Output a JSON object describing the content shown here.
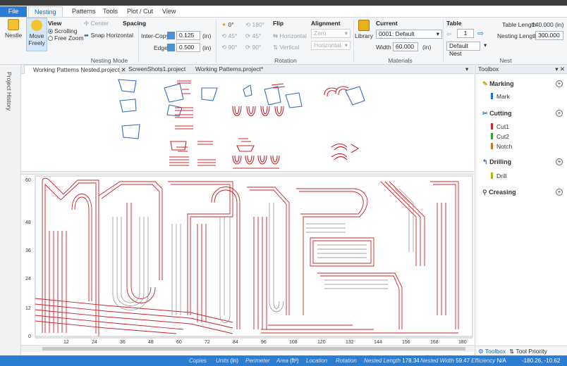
{
  "menu": {
    "file": "File",
    "tabs": [
      "Nesting",
      "Patterns",
      "Tools",
      "Plot / Cut",
      "View"
    ]
  },
  "ribbon": {
    "nestle": "Nestle",
    "move_freely": "Move Freely",
    "view_title": "View",
    "scrolling": "Scrolling",
    "free_zoom": "Free Zoom",
    "center": "Center",
    "snap_horizontal": "Snap Horizontal",
    "nesting_mode": "Nesting Mode",
    "spacing_title": "Spacing",
    "inter_copy_label": "Inter-Copy",
    "inter_copy_value": "0.125",
    "inter_copy_unit": "(in)",
    "edge_label": "Edge",
    "edge_value": "0.500",
    "edge_unit": "(in)",
    "rot_0": "0°",
    "rot_180": "180°",
    "rot_45a": "45°",
    "rot_45b": "45°",
    "rot_90a": "90°",
    "rot_90b": "90°",
    "flip_title": "Flip",
    "flip_horizontal": "Horizontal",
    "flip_vertical": "Vertical",
    "align_title": "Alignment",
    "align_zero": "Zero",
    "align_horizontal": "Horizontal",
    "rotation": "Rotation",
    "library": "Library",
    "current_title": "Current",
    "current_material": "0001: Default",
    "width_label": "Width",
    "width_value": "60.000",
    "width_unit": "(in)",
    "materials": "Materials",
    "table_title": "Table",
    "table_value": "1",
    "default_nest": "Default Nest",
    "table_length_label": "Table Length",
    "table_length_value": "140.000 (in)",
    "nesting_length_label": "Nesting Length",
    "nesting_length_value": "300.000",
    "nest": "Nest"
  },
  "sidebar": {
    "label": "Project History"
  },
  "doc_tabs": [
    "Working Patterns Nested.project",
    "ScreenShots1.project",
    "Working Patterns.project*"
  ],
  "nest_axes": {
    "y": [
      "60",
      "48",
      "36",
      "24",
      "12",
      "0"
    ],
    "x": [
      "12",
      "24",
      "36",
      "48",
      "60",
      "72",
      "84",
      "96",
      "108",
      "120",
      "132",
      "144",
      "156",
      "168",
      "180"
    ]
  },
  "toolbox": {
    "title": "Toolbox",
    "categories": [
      {
        "name": "Marking",
        "items": [
          {
            "label": "Mark",
            "color": "#1f6fd1"
          }
        ]
      },
      {
        "name": "Cutting",
        "items": [
          {
            "label": "Cut1",
            "color": "#d62828"
          },
          {
            "label": "Cut2",
            "color": "#2aa52a"
          },
          {
            "label": "Notch",
            "color": "#c47a1c"
          }
        ]
      },
      {
        "name": "Drilling",
        "items": [
          {
            "label": "Drill",
            "color": "#b7b214"
          }
        ]
      },
      {
        "name": "Creasing",
        "items": []
      }
    ],
    "footer_tab1": "Toolbox",
    "footer_tab2": "Tool Priority"
  },
  "status": {
    "copies": "Copies",
    "units_label": "Units",
    "units_value": "(in)",
    "perimeter": "Perimeter",
    "area_label": "Area",
    "area_value": "(ft²)",
    "location": "Location",
    "rotation": "Rotation",
    "nested_length_label": "Nested Length",
    "nested_length_value": "178.34",
    "nested_width_label": "Nested Width",
    "nested_width_value": "59.47",
    "efficiency_label": "Efficiency",
    "efficiency_value": "N/A",
    "coords": "-180.26, -10.62"
  }
}
